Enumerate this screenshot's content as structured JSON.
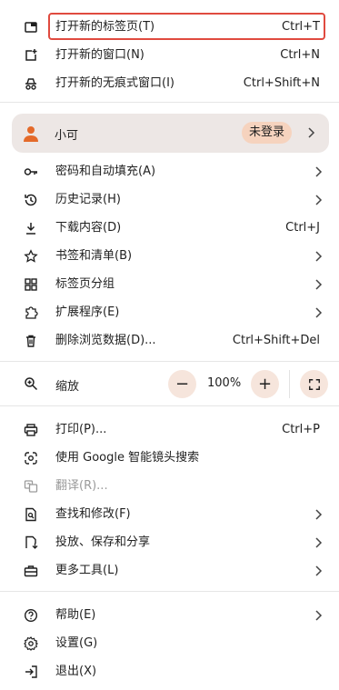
{
  "colors": {
    "highlight": "#e04a3f",
    "profile_bg": "#ede7e5",
    "badge_bg": "#f6d3be",
    "zoom_btn_bg": "#f6e5dc"
  },
  "top_items": [
    {
      "icon": "new-tab-icon",
      "label": "打开新的标签页(T)",
      "shortcut": "Ctrl+T"
    },
    {
      "icon": "new-window-icon",
      "label": "打开新的窗口(N)",
      "shortcut": "Ctrl+N"
    },
    {
      "icon": "incognito-icon",
      "label": "打开新的无痕式窗口(I)",
      "shortcut": "Ctrl+Shift+N"
    }
  ],
  "profile": {
    "name": "小可",
    "status": "未登录"
  },
  "middle_items": [
    {
      "icon": "key-icon",
      "label": "密码和自动填充(A)"
    },
    {
      "icon": "history-icon",
      "label": "历史记录(H)"
    },
    {
      "icon": "download-icon",
      "label": "下载内容(D)",
      "shortcut": "Ctrl+J"
    },
    {
      "icon": "star-icon",
      "label": "书签和清单(B)"
    },
    {
      "icon": "tab-groups-icon",
      "label": "标签页分组"
    },
    {
      "icon": "extension-icon",
      "label": "扩展程序(E)"
    },
    {
      "icon": "trash-icon",
      "label": "删除浏览数据(D)...",
      "shortcut": "Ctrl+Shift+Del"
    }
  ],
  "zoom": {
    "label": "缩放",
    "minus": "−",
    "value": "100%",
    "plus": "+"
  },
  "tools_items": [
    {
      "icon": "print-icon",
      "label": "打印(P)...",
      "shortcut": "Ctrl+P"
    },
    {
      "icon": "google-lens-icon",
      "label": "使用 Google 智能镜头搜索"
    },
    {
      "icon": "translate-icon",
      "label": "翻译(R)..."
    },
    {
      "icon": "find-icon",
      "label": "查找和修改(F)"
    },
    {
      "icon": "cast-save-share-icon",
      "label": "投放、保存和分享"
    },
    {
      "icon": "toolbox-icon",
      "label": "更多工具(L)"
    }
  ],
  "bottom_items": [
    {
      "icon": "help-icon",
      "label": "帮助(E)"
    },
    {
      "icon": "settings-icon",
      "label": "设置(G)"
    },
    {
      "icon": "exit-icon",
      "label": "退出(X)"
    }
  ]
}
